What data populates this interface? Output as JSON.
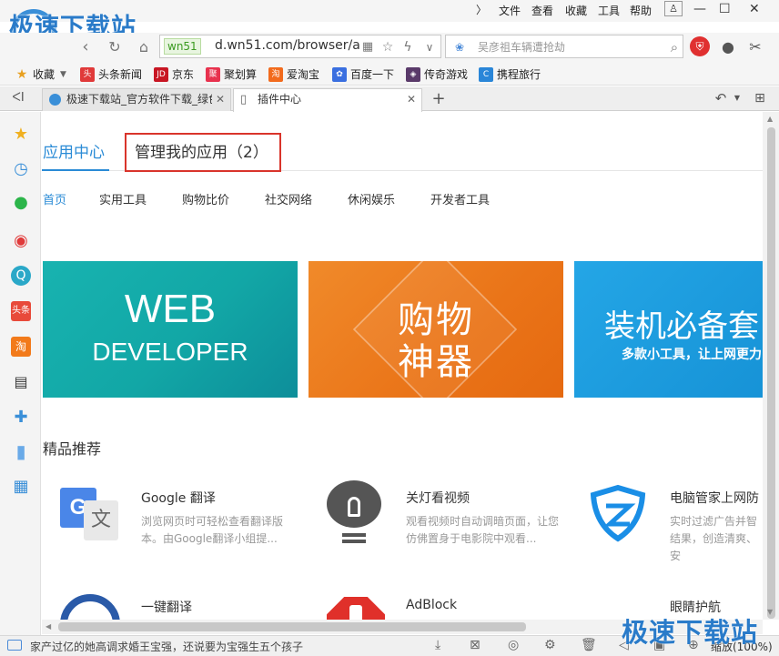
{
  "window": {
    "menu": [
      "文件",
      "查看",
      "收藏",
      "工具",
      "帮助"
    ],
    "watermark_top": "极速下载站",
    "watermark_bottom": "极速下载站"
  },
  "address": {
    "badge": "wn51",
    "url": "d.wn51.com/browser/a",
    "search_placeholder": "吴彦祖车辆遭抢劫"
  },
  "bookmarks": [
    {
      "label": "收藏",
      "icon": "star-icon"
    },
    {
      "label": "头条新闻",
      "icon": "toutiao-icon"
    },
    {
      "label": "京东",
      "icon": "jd-icon"
    },
    {
      "label": "聚划算",
      "icon": "juhuasuan-icon"
    },
    {
      "label": "爱淘宝",
      "icon": "taobao-icon"
    },
    {
      "label": "百度一下",
      "icon": "baidu-icon"
    },
    {
      "label": "传奇游戏",
      "icon": "game-icon"
    },
    {
      "label": "携程旅行",
      "icon": "ctrip-icon"
    }
  ],
  "tabs": [
    {
      "label": "极速下载站_官方软件下载_绿色",
      "active": false
    },
    {
      "label": "插件中心",
      "active": true
    }
  ],
  "page": {
    "header_active": "应用中心",
    "header_manage": "管理我的应用（2）",
    "categories": [
      "首页",
      "实用工具",
      "购物比价",
      "社交网络",
      "休闲娱乐",
      "开发者工具"
    ],
    "banners": [
      {
        "line1": "WEB",
        "line2": "DEVELOPER"
      },
      {
        "line1": "购物",
        "line2": "神器"
      },
      {
        "line1": "装机必备套",
        "line2": "多款小工具，让上网更力"
      }
    ],
    "section_title": "精品推荐",
    "apps": [
      {
        "name": "Google 翻译",
        "desc": "浏览网页时可轻松查看翻译版本。由Google翻译小组提..."
      },
      {
        "name": "关灯看视频",
        "desc": "观看视频时自动调暗页面，让您仿佛置身于电影院中观看..."
      },
      {
        "name": "电脑管家上网防",
        "desc": "实时过滤广告并智结果，创造清爽、安"
      },
      {
        "name": "一键翻译",
        "desc": ""
      },
      {
        "name": "AdBlock",
        "desc": ""
      },
      {
        "name": "眼睛护航",
        "desc": ""
      }
    ]
  },
  "status": {
    "text": "家产过亿的她高调求婚王宝强，还说要为宝强生五个孩子",
    "zoom": "缩放(100%)"
  }
}
